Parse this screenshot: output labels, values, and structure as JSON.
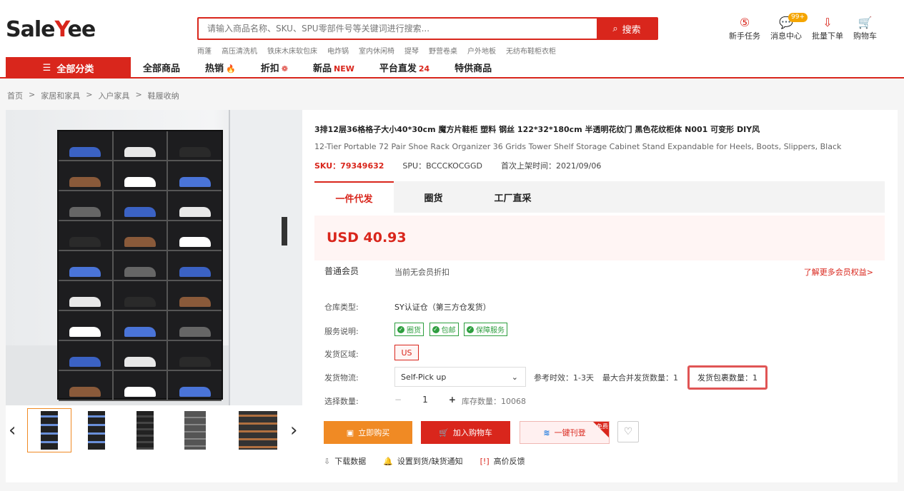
{
  "header": {
    "logo_prefix": "Sale",
    "logo_y": "Y",
    "logo_suffix": "ee",
    "search_placeholder": "请输入商品名称、SKU、SPU零部件号等关键词进行搜索...",
    "search_button": "搜索",
    "hot_words": [
      "雨蓬",
      "高压清洗机",
      "铁床木床软包床",
      "电炸锅",
      "室内休闲椅",
      "提琴",
      "野营卷桌",
      "户外地板",
      "无纺布鞋柜衣柜"
    ],
    "icons": [
      {
        "name": "newbie-tasks",
        "label": "新手任务",
        "glyph": "⑤"
      },
      {
        "name": "message-center",
        "label": "消息中心",
        "glyph": "💬",
        "badge": "99+"
      },
      {
        "name": "bulk-order",
        "label": "批量下单",
        "glyph": "⇩"
      },
      {
        "name": "cart",
        "label": "购物车",
        "glyph": "🛒"
      }
    ]
  },
  "nav": {
    "all_categories": "全部分类",
    "items": [
      "全部商品",
      "热销",
      "折扣",
      "新品",
      "平台直发",
      "特供商品"
    ],
    "marks": [
      "",
      "🔥",
      "❁",
      "NEW",
      "24",
      ""
    ]
  },
  "breadcrumb": [
    "首页",
    ">",
    "家居和家具",
    ">",
    "入户家具",
    ">",
    "鞋履收纳"
  ],
  "product": {
    "title": "3排12层36格格子大小40*30cm 魔方片鞋柜 塑料 钢丝 122*32*180cm 半透明花纹门 黑色花纹柜体 N001 可变形 DIY风",
    "subtitle": "12-Tier Portable 72 Pair Shoe Rack Organizer 36 Grids Tower Shelf Storage Cabinet Stand Expandable for Heels, Boots, Slippers, Black",
    "sku": "SKU：79349632",
    "spu": "SPU：BCCCKOCGGD",
    "first_listed": "首次上架时间：2021/09/06"
  },
  "tabs": [
    "一件代发",
    "圈货",
    "工厂直采"
  ],
  "price": "USD 40.93",
  "member": {
    "level": "普通会员",
    "note": "当前无会员折扣",
    "link": "了解更多会员权益>"
  },
  "fields": {
    "warehouse_label": "仓库类型:",
    "warehouse_value": "SY认证仓（第三方仓发货）",
    "service_label": "服务说明:",
    "service_tags": [
      "圈货",
      "包邮",
      "保障服务"
    ],
    "region_label": "发货区域:",
    "region_value": "US",
    "logistics_label": "发货物流:",
    "logistics_value": "Self-Pick up",
    "ref_time": "参考时效：1-3天",
    "max_merge": "最大合并发货数量：1",
    "package_count": "发货包裹数量：1",
    "qty_label": "选择数量:",
    "qty_value": "1",
    "stock": "库存数量：10068"
  },
  "buttons": {
    "buy": "立即购买",
    "cart": "加入购物车",
    "publish": "一键刊登",
    "free": "免费"
  },
  "extra_links": [
    "下载数据",
    "设置到货/缺货通知",
    "高价反馈"
  ],
  "colors": {
    "brand_red": "#d9261c",
    "orange": "#f08a24",
    "green": "#2e9e3f"
  }
}
